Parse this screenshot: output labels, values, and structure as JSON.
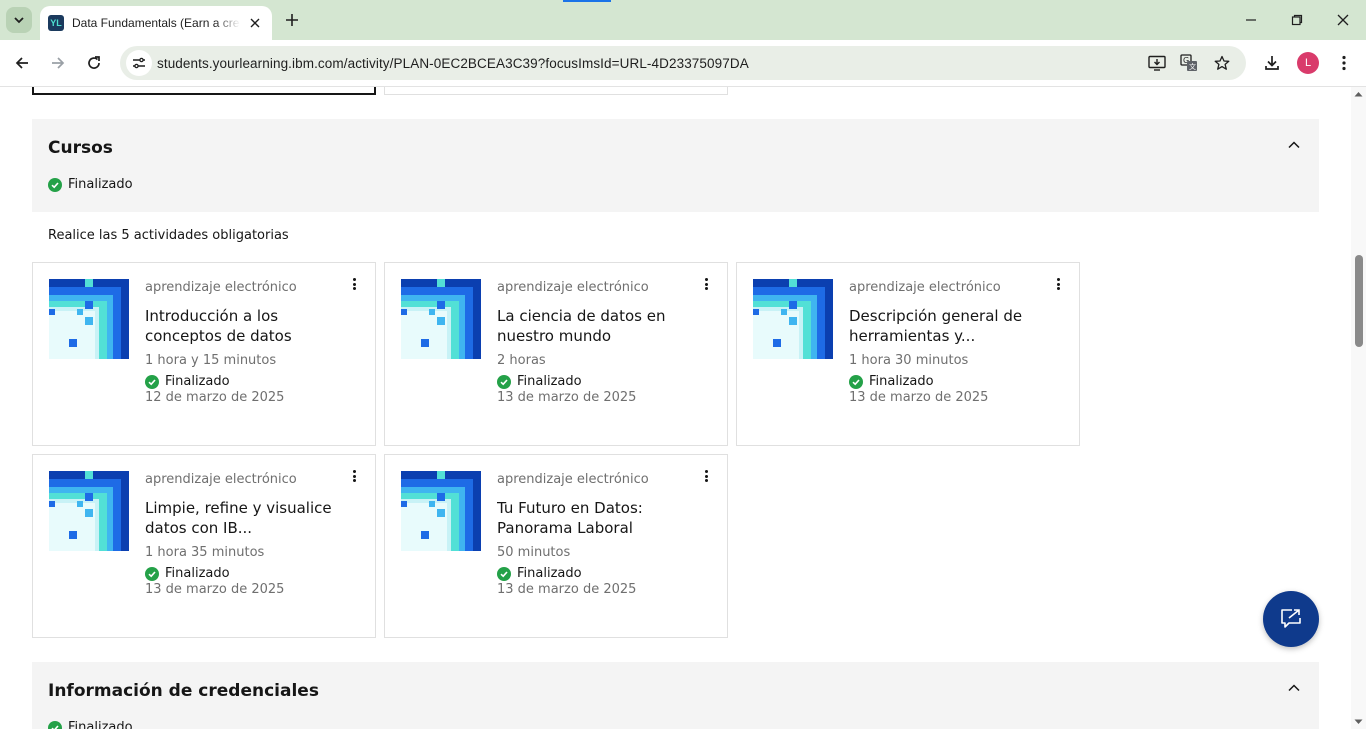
{
  "browser": {
    "tab_title": "Data Fundamentals (Earn a credential)",
    "url": "students.yourlearning.ibm.com/activity/PLAN-0EC2BCEA3C39?focusImsId=URL-4D23375097DA",
    "profile_initial": "L",
    "favicon_text": "YL",
    "accent_color": "#1a73e8"
  },
  "courses_section": {
    "title": "Cursos",
    "status": "Finalizado",
    "instructions": "Realice las 5 actividades obligatorias"
  },
  "cards": [
    {
      "type": "aprendizaje electrónico",
      "title": "Introducción a los conceptos de datos",
      "duration": "1 hora y 15 minutos",
      "status": "Finalizado",
      "date": "12 de marzo de 2025"
    },
    {
      "type": "aprendizaje electrónico",
      "title": "La ciencia de datos en nuestro mundo",
      "duration": "2 horas",
      "status": "Finalizado",
      "date": "13 de marzo de 2025"
    },
    {
      "type": "aprendizaje electrónico",
      "title": "Descripción general de herramientas y...",
      "duration": "1 hora 30 minutos",
      "status": "Finalizado",
      "date": "13 de marzo de 2025"
    },
    {
      "type": "aprendizaje electrónico",
      "title": "Limpie, refine y visualice datos con IB...",
      "duration": "1 hora 35 minutos",
      "status": "Finalizado",
      "date": "13 de marzo de 2025"
    },
    {
      "type": "aprendizaje electrónico",
      "title": "Tu Futuro en Datos: Panorama Laboral",
      "duration": "50 minutos",
      "status": "Finalizado",
      "date": "13 de marzo de 2025"
    }
  ],
  "credentials_section": {
    "title": "Información de credenciales",
    "status": "Finalizado"
  },
  "colors": {
    "success": "#24a148",
    "fab": "#0f3a8c",
    "section_bg": "#f4f4f4"
  },
  "icons": {
    "tab_search": "chevron-down-icon",
    "fab": "chat-launch-icon",
    "thumbnail": "pixel-grid-thumbnail"
  }
}
